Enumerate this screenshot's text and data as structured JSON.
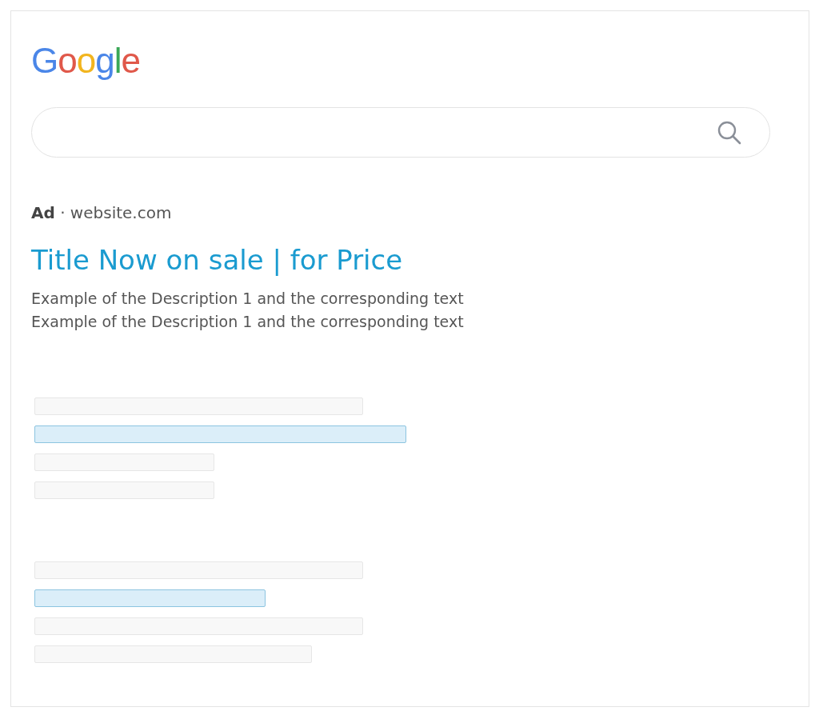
{
  "logo": "Google",
  "ad": {
    "source": "**Ad** · website.com",
    "title": "Title Now on sale | for Price",
    "descriptions": [
      "Example of the Description 1 and the corresponding text",
      "Example of the Description 1 and the corresponding text"
    ]
  },
  "placeholder_results": [
    {
      "lines": [
        {
          "kind": "text"
        },
        {
          "kind": "link"
        },
        {
          "kind": "text"
        },
        {
          "kind": "text"
        }
      ]
    },
    {
      "lines": [
        {
          "kind": "text"
        },
        {
          "kind": "link"
        },
        {
          "kind": "text"
        },
        {
          "kind": "text"
        }
      ]
    }
  ]
}
